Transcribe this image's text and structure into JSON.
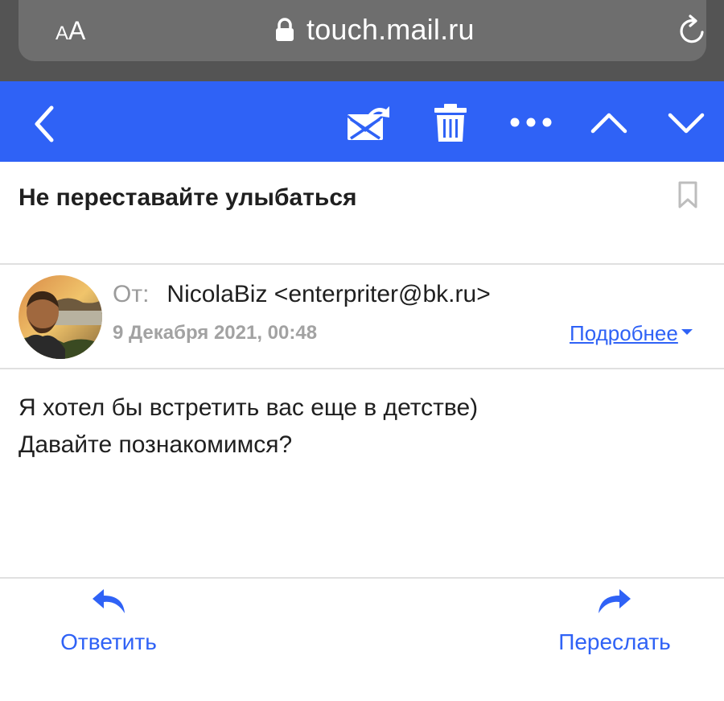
{
  "browser": {
    "text_size_small": "A",
    "text_size_big": "A",
    "url": "touch.mail.ru",
    "icons": [
      "lock-icon",
      "reload-icon"
    ]
  },
  "toolbar": {
    "color": "#2f62f6",
    "icons": [
      "back-icon",
      "spam-icon",
      "trash-icon",
      "more-icon",
      "prev-message-icon",
      "next-message-icon"
    ]
  },
  "message": {
    "subject": "Не переставайте улыбаться",
    "from_label": "От:",
    "from_value": "NicolaBiz <enterpriter@bk.ru>",
    "date": "9 Декабря 2021, 00:48",
    "details_link": "Подробнее",
    "body_lines": [
      "Я хотел бы встретить вас еще в детстве)",
      "Давайте познакомимся?"
    ]
  },
  "actions": {
    "reply_label": "Ответить",
    "forward_label": "Переслать"
  },
  "colors": {
    "accent": "#2f62f6",
    "text": "#1f1f1f",
    "muted": "#9b9b9b"
  }
}
